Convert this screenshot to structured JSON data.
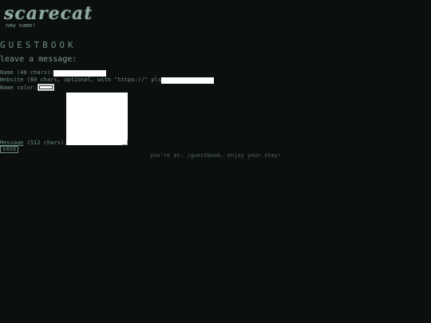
{
  "header": {
    "logo": "scarecat",
    "subtitle": "new name!"
  },
  "guestbook": {
    "title": "GUESTBOOK",
    "form_heading": "leave a message:",
    "name_label": "Name (40 chars):",
    "name_value": "",
    "website_label": "Website (80 chars, optional, with \"https://\" pls):",
    "website_value": "",
    "color_label": "Name color:",
    "color_value": "#ffffff",
    "message_link": "Message",
    "message_label_suffix": " (512 chars):",
    "message_value": "",
    "send_label": "send"
  },
  "footer": {
    "text": "you're at: /guestbook. enjoy your stay!"
  }
}
